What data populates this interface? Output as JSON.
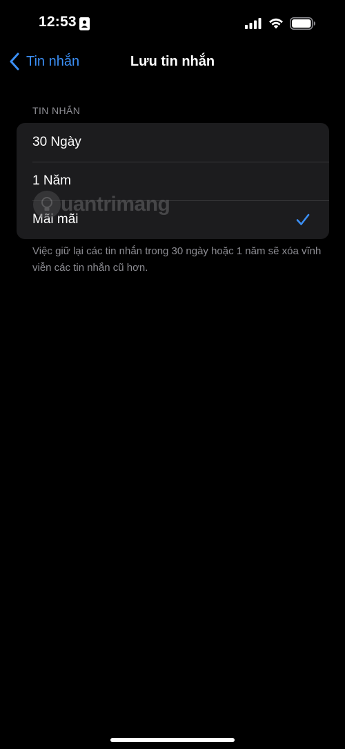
{
  "status_bar": {
    "time": "12:53",
    "icons": [
      "id-card-icon",
      "signal-icon",
      "wifi-icon",
      "battery-icon"
    ]
  },
  "nav": {
    "back_label": "Tin nhắn",
    "title": "Lưu tin nhắn"
  },
  "section": {
    "header": "TIN NHẮN",
    "options": [
      {
        "label": "30 Ngày",
        "selected": false
      },
      {
        "label": "1 Năm",
        "selected": false
      },
      {
        "label": "Mãi mãi",
        "selected": true
      }
    ],
    "footer": "Việc giữ lại các tin nhắn trong 30 ngày hoặc 1 năm sẽ xóa vĩnh viễn các tin nhắn cũ hơn."
  },
  "watermark": {
    "text": "uantrimang"
  },
  "colors": {
    "background": "#000000",
    "group_background": "#1c1c1e",
    "accent": "#3b8ff5",
    "secondary_text": "#8d8d93"
  }
}
